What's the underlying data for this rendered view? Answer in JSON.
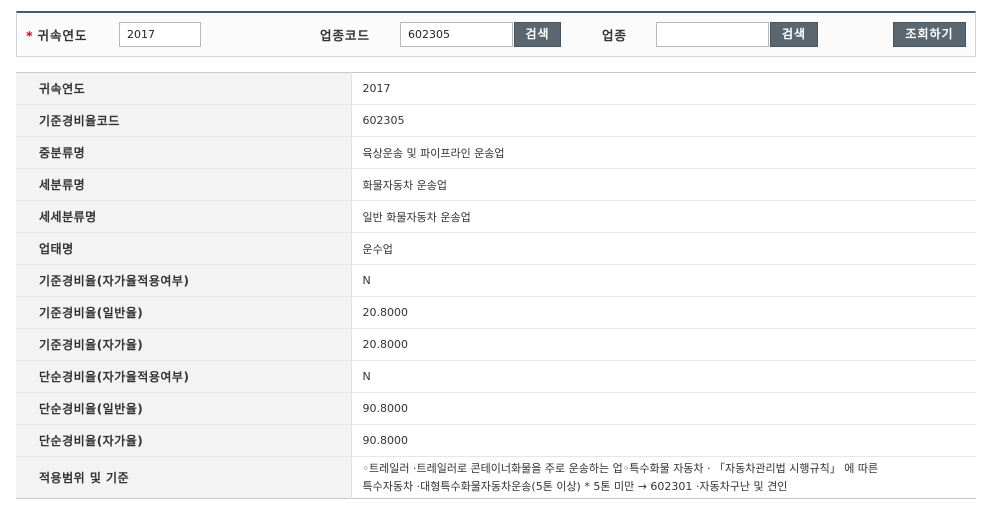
{
  "search": {
    "year_label": "귀속연도",
    "year_value": "2017",
    "code_label": "업종코드",
    "code_value": "602305",
    "search_btn_1": "검색",
    "industry_label": "업종",
    "industry_value": "",
    "search_btn_2": "검색",
    "submit_btn": "조회하기",
    "required_mark": "*"
  },
  "details": [
    {
      "label": "귀속연도",
      "value": "2017"
    },
    {
      "label": "기준경비율코드",
      "value": "602305"
    },
    {
      "label": "중분류명",
      "value": "육상운송 및 파이프라인 운송업"
    },
    {
      "label": "세분류명",
      "value": "화물자동차 운송업"
    },
    {
      "label": "세세분류명",
      "value": "일반 화물자동차 운송업"
    },
    {
      "label": "업태명",
      "value": "운수업"
    },
    {
      "label": "기준경비율(자가율적용여부)",
      "value": "N"
    },
    {
      "label": "기준경비율(일반율)",
      "value": "20.8000"
    },
    {
      "label": "기준경비율(자가율)",
      "value": "20.8000"
    },
    {
      "label": "단순경비율(자가율적용여부)",
      "value": "N"
    },
    {
      "label": "단순경비율(일반율)",
      "value": "90.8000"
    },
    {
      "label": "단순경비율(자가율)",
      "value": "90.8000"
    },
    {
      "label": "적용범위 및 기준",
      "value_line1": "◦트레일러 ·트레일러로 콘테이너화물을 주로 운송하는 업◦특수화물 자동차 · 「자동차관리법 시행규칙」 에 따른",
      "value_line2": "특수자동차 ·대형특수화물자동차운송(5톤 이상) * 5톤 미만 → 602301 ·자동차구난 및 견인"
    }
  ]
}
